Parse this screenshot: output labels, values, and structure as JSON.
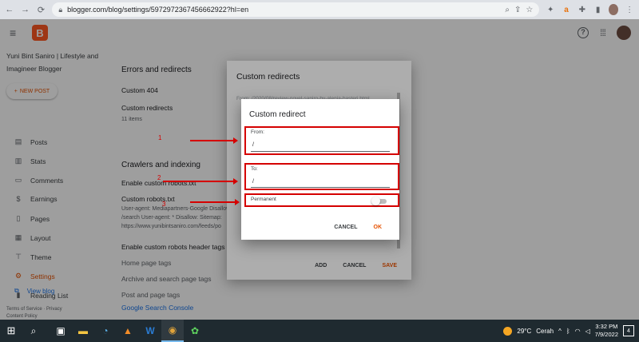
{
  "browser": {
    "url": "blogger.com/blog/settings/5972972367456662922?hl=en",
    "extension_a_label": "a",
    "extension_badge": "8"
  },
  "app": {
    "logo_letter": "B",
    "help_symbol": "?",
    "blog_title": "Yuni Bint Saniro | Lifestyle and Imagineer Blogger",
    "new_post_label": "NEW POST",
    "nav": [
      {
        "label": "Posts",
        "icon": "posts-icon"
      },
      {
        "label": "Stats",
        "icon": "stats-icon"
      },
      {
        "label": "Comments",
        "icon": "comments-icon"
      },
      {
        "label": "Earnings",
        "icon": "earnings-icon"
      },
      {
        "label": "Pages",
        "icon": "pages-icon"
      },
      {
        "label": "Layout",
        "icon": "layout-icon"
      },
      {
        "label": "Theme",
        "icon": "theme-icon"
      },
      {
        "label": "Settings",
        "icon": "settings-icon"
      },
      {
        "label": "Reading List",
        "icon": "reading-list-icon"
      }
    ],
    "view_blog": "View blog",
    "tos": "Terms of Service · Privacy",
    "tos_extra": "Content Policy"
  },
  "settings": {
    "errors_heading": "Errors and redirects",
    "custom_404": "Custom 404",
    "custom_redirects": "Custom redirects",
    "custom_redirects_sub": "11 items",
    "crawlers_heading": "Crawlers and indexing",
    "enable_robots": "Enable custom robots.txt",
    "custom_robots": "Custom robots.txt",
    "robots_line1": "User-agent: Mediapartners-Google Disallow:",
    "robots_line2": "/search User-agent: * Disallow: Sitemap:",
    "robots_line3": "https://www.yunibintsaniro.com/feeds/po",
    "enable_header_tags": "Enable custom robots header tags",
    "home_tags": "Home page tags",
    "archive_tags": "Archive and search page tags",
    "post_tags": "Post and page tags",
    "search_console": "Google Search Console"
  },
  "redirects_dialog": {
    "title": "Custom redirects",
    "first_line": "From: /2020/08/review-novel-saniro-by-alenia-hasteri.html",
    "add": "ADD",
    "cancel": "CANCEL",
    "save": "SAVE"
  },
  "redirect_dialog": {
    "title": "Custom redirect",
    "from_label": "From:",
    "from_value": "/",
    "to_label": "To:",
    "to_value": "/",
    "permanent_label": "Permanent",
    "permanent_on": false,
    "cancel": "CANCEL",
    "ok": "OK"
  },
  "annotations": [
    "1",
    "2",
    "3"
  ],
  "taskbar": {
    "temperature": "29°C",
    "weather": "Cerah",
    "time": "3:32 PM",
    "date": "7/9/2022",
    "notifications": "4"
  },
  "colors": {
    "accent": "#e65100",
    "annotation": "#d50000",
    "taskbar": "#1f2a30"
  }
}
